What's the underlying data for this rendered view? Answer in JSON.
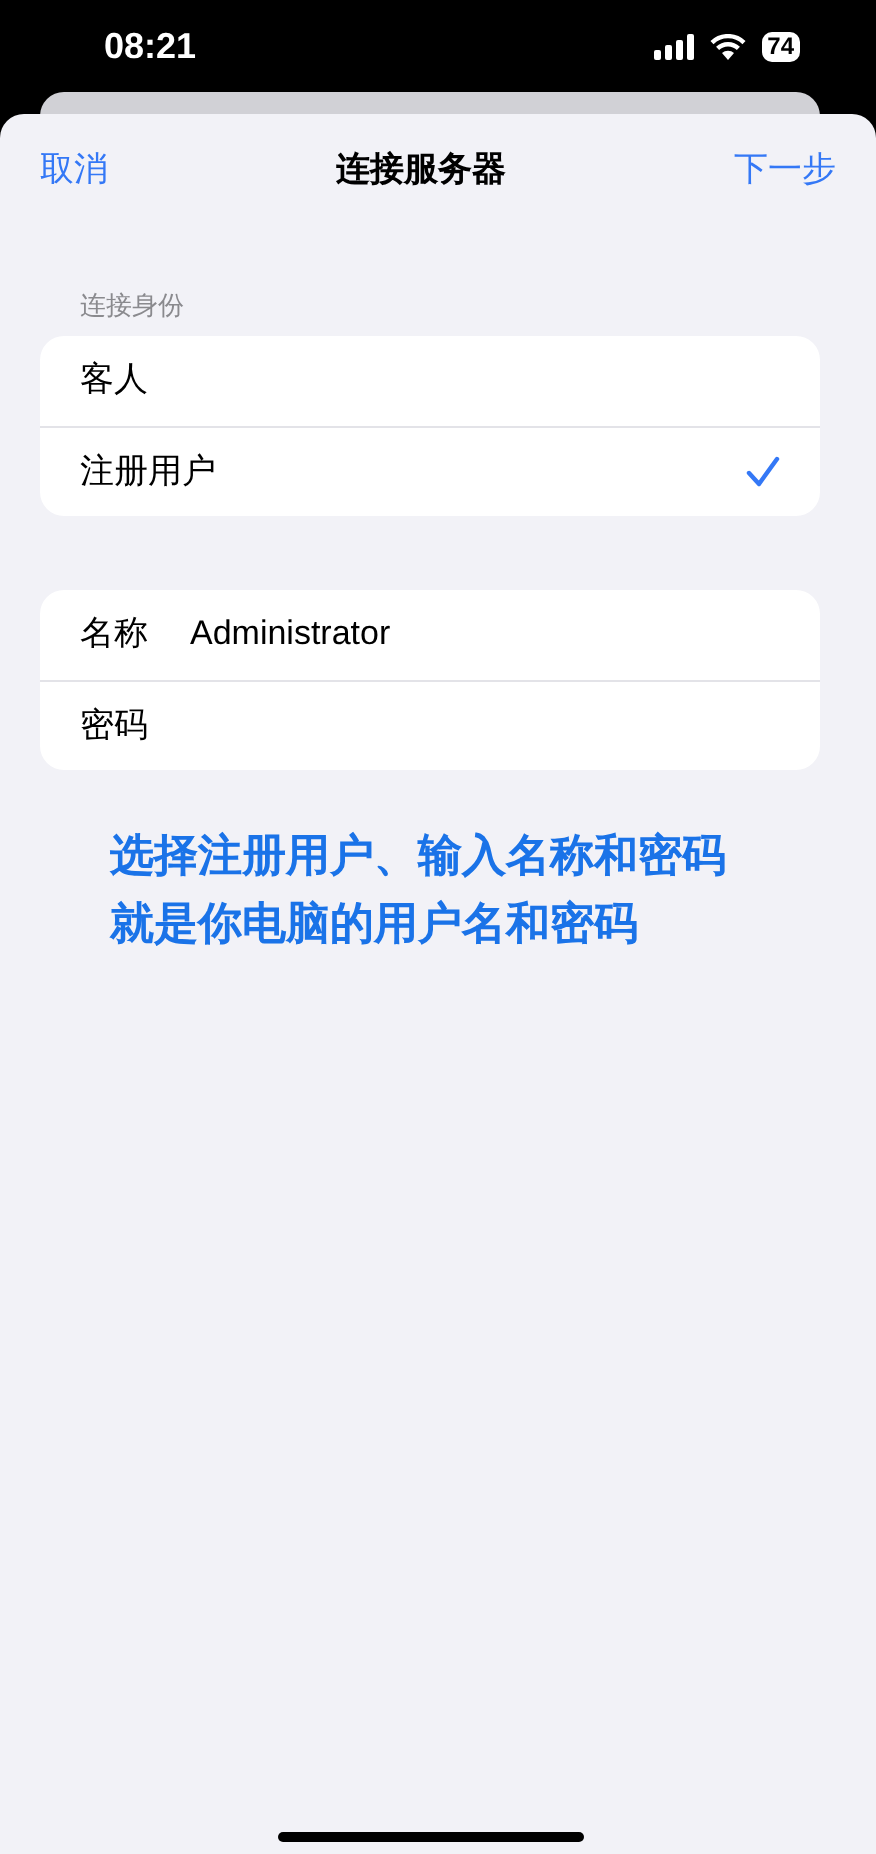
{
  "status_bar": {
    "time": "08:21",
    "battery": "74"
  },
  "nav": {
    "cancel": "取消",
    "title": "连接服务器",
    "next": "下一步"
  },
  "identity": {
    "header": "连接身份",
    "options": [
      {
        "label": "客人",
        "selected": false
      },
      {
        "label": "注册用户",
        "selected": true
      }
    ]
  },
  "credentials": [
    {
      "label": "名称",
      "value": "Administrator"
    },
    {
      "label": "密码"
    }
  ],
  "annotation_lines": [
    "选择注册用户、输入名称和密码",
    "就是你电脑的用户名和密码"
  ]
}
